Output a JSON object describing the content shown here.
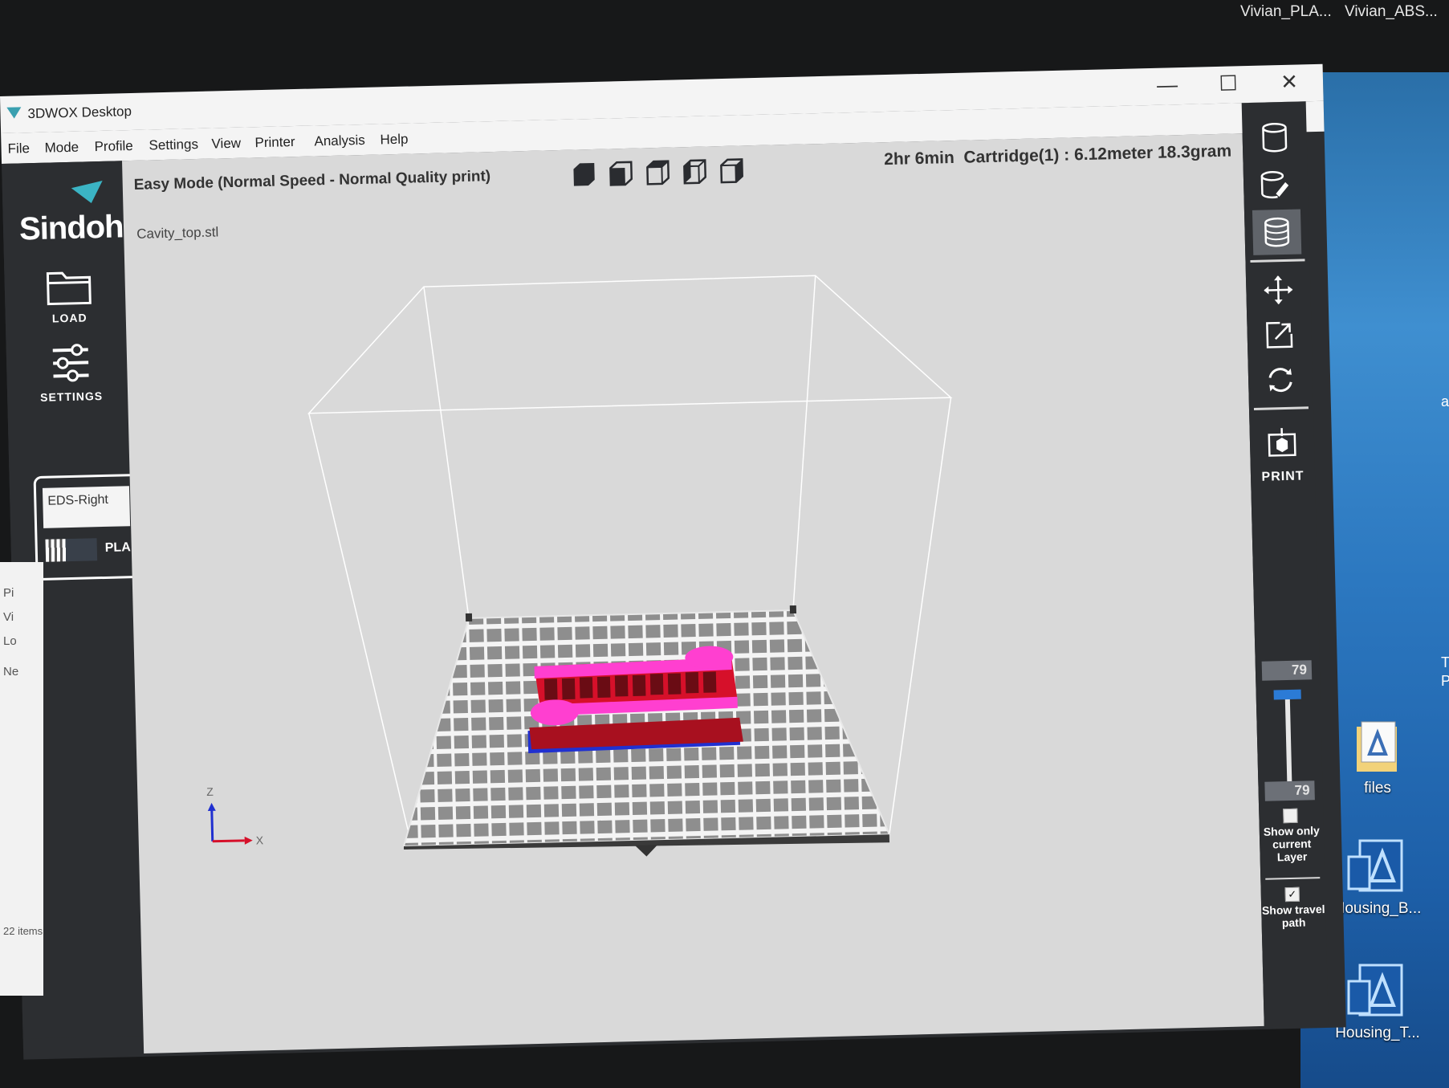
{
  "desktop": {
    "top_labels": [
      "Vivian_PLA...",
      "Vivian_ABS..."
    ],
    "icons": [
      {
        "label": "files",
        "icon": "folder-document-icon"
      },
      {
        "label": "Housing_B...",
        "icon": "app-document-icon"
      },
      {
        "label": "Housing_T...",
        "icon": "app-document-icon"
      }
    ],
    "edge_fragments": [
      "a",
      "T",
      "P"
    ]
  },
  "window": {
    "title": "3DWOX Desktop",
    "controls": {
      "minimize": "—",
      "maximize": "☐",
      "close": "✕"
    }
  },
  "menu": [
    "File",
    "Mode",
    "Profile",
    "Settings",
    "View",
    "Printer",
    "Analysis",
    "Help"
  ],
  "sidebar": {
    "brand": "Sindoh",
    "load_label": "LOAD",
    "settings_label": "SETTINGS",
    "material": {
      "name": "EDS-Right",
      "type": "PLA"
    }
  },
  "explorer": {
    "items": [
      "Pi",
      "Vi",
      "Lo",
      "Ne"
    ],
    "status": "22 items"
  },
  "viewport": {
    "mode": "Easy Mode (Normal Speed - Normal Quality print)",
    "file": "Cavity_top.stl",
    "print_time": "2hr 6min",
    "cartridge": "Cartridge(1) : 6.12meter 18.3gram",
    "axes": {
      "z": "Z",
      "x": "X"
    },
    "view_buttons": [
      "view-iso-icon",
      "view-front-icon",
      "view-top-icon",
      "view-left-icon",
      "view-right-icon"
    ]
  },
  "right_toolbar": {
    "tools": [
      "normal-view-icon",
      "overhang-view-icon",
      "layer-view-icon",
      "move-icon",
      "scale-icon",
      "rotate-icon"
    ],
    "print_label": "PRINT",
    "layer_top": "79",
    "layer_bottom": "79",
    "layer_slider_level": 1.0,
    "show_only_current_layer": {
      "label": "Show only current Layer",
      "checked": false
    },
    "show_travel_path": {
      "label": "Show travel path",
      "checked": true
    }
  },
  "colors": {
    "model_pink": "#ff3fd0",
    "model_red": "#d6102a",
    "model_base_blue": "#2030d0",
    "accent_blue": "#2b7bd6"
  }
}
